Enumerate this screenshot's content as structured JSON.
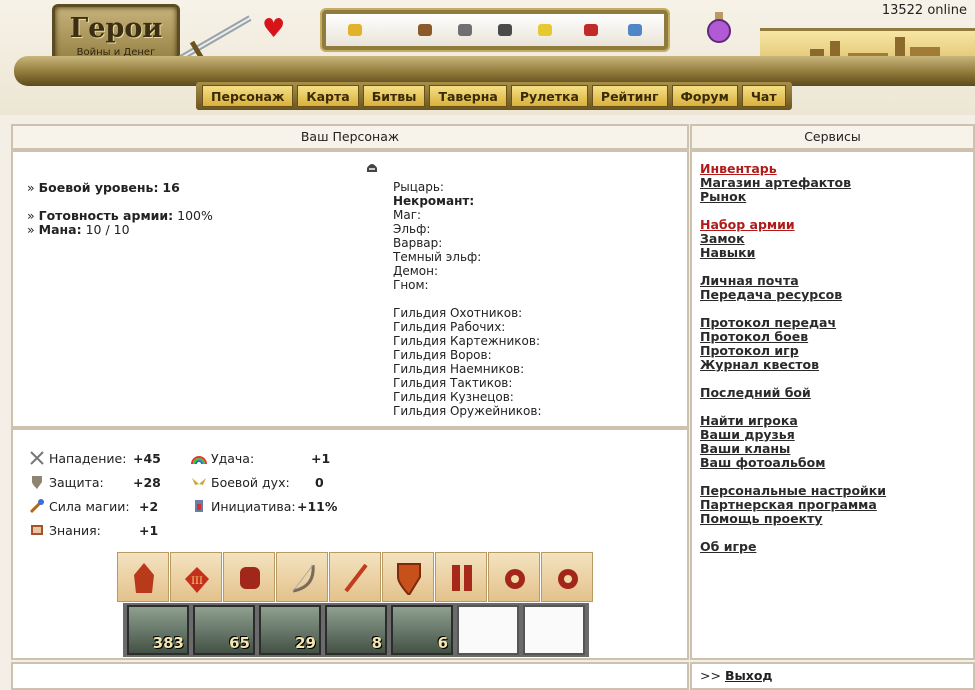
{
  "header": {
    "online_text": "13522 online",
    "logo": {
      "title": "Герои",
      "subtitle": "Войны и Денег"
    },
    "icons": [
      "heart-icon",
      "sword-icon",
      "potion-icon",
      "castle-banner"
    ],
    "nav": [
      "Персонаж",
      "Карта",
      "Битвы",
      "Таверна",
      "Рулетка",
      "Рейтинг",
      "Форум",
      "Чат"
    ]
  },
  "character": {
    "title": "Ваш Персонаж",
    "level_label": "Боевой уровень:",
    "level_value": "16",
    "army_label": "Готовность армии:",
    "army_value": "100%",
    "mana_label": "Мана:",
    "mana_value": "10 / 10",
    "factions": [
      "Рыцарь:",
      "Некромант:",
      "Маг:",
      "Эльф:",
      "Варвар:",
      "Темный эльф:",
      "Демон:",
      "Гном:"
    ],
    "guilds": [
      "Гильдия Охотников:",
      "Гильдия Рабочих:",
      "Гильдия Картежников:",
      "Гильдия Воров:",
      "Гильдия Наемников:",
      "Гильдия Тактиков:",
      "Гильдия Кузнецов:",
      "Гильдия Оружейников:"
    ]
  },
  "stats": {
    "attack_label": "Нападение:",
    "attack_value": "+45",
    "defense_label": "Защита:",
    "defense_value": "+28",
    "spellpower_label": "Сила магии:",
    "spellpower_value": "+2",
    "knowledge_label": "Знания:",
    "knowledge_value": "+1",
    "luck_label": "Удача:",
    "luck_value": "+1",
    "morale_label": "Боевой дух:",
    "morale_value": "0",
    "initiative_label": "Инициатива:",
    "initiative_value": "+11%"
  },
  "artifacts": [
    "helmet",
    "amulet",
    "armor",
    "bow",
    "sword",
    "shield",
    "boots",
    "ring",
    "ring"
  ],
  "troops": [
    "383",
    "65",
    "29",
    "8",
    "6",
    "",
    ""
  ],
  "services": {
    "title": "Сервисы",
    "groups": [
      [
        "Инвентарь",
        "Магазин артефактов",
        "Рынок"
      ],
      [
        "Набор армии",
        "Замок",
        "Навыки"
      ],
      [
        "Личная почта",
        "Передача ресурсов"
      ],
      [
        "Протокол передач",
        "Протокол боев",
        "Протокол игр",
        "Журнал квестов"
      ],
      [
        "Последний бой"
      ],
      [
        "Найти игрока",
        "Ваши друзья",
        "Ваши кланы",
        "Ваш фотоальбом"
      ],
      [
        "Персональные настройки",
        "Партнерская программа",
        "Помощь проекту"
      ],
      [
        "Об игре"
      ]
    ],
    "red_items": [
      "Инвентарь",
      "Набор армии"
    ]
  },
  "footer": {
    "logout_prefix": ">>",
    "logout_label": "Выход"
  }
}
